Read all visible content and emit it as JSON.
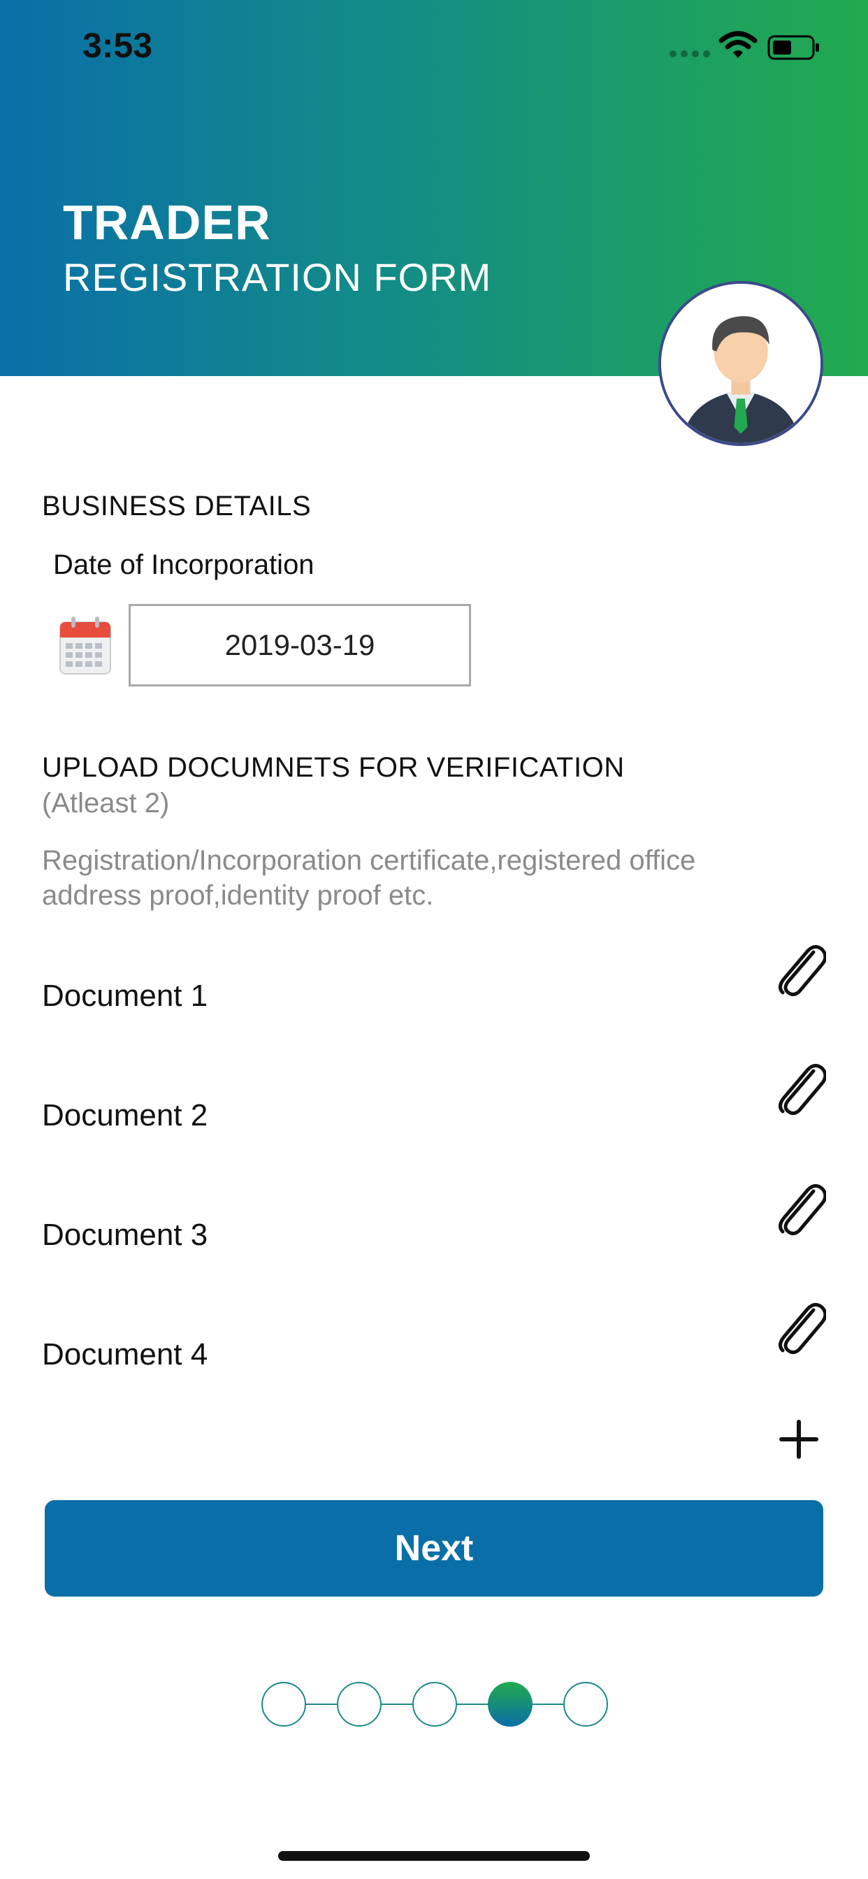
{
  "status_bar": {
    "time": "3:53"
  },
  "header": {
    "title": "TRADER",
    "subtitle": "REGISTRATION FORM",
    "avatar_icon": "businessman-avatar-icon"
  },
  "business": {
    "section_title": "BUSINESS DETAILS",
    "date_label": "Date of Incorporation",
    "date_value": "2019-03-19",
    "calendar_icon": "calendar-icon"
  },
  "upload": {
    "section_title": "UPLOAD DOCUMNETS FOR VERIFICATION",
    "note": "(Atleast 2)",
    "description_line1": "Registration/Incorporation certificate,registered office",
    "description_line2": "address proof,identity proof etc.",
    "documents": [
      {
        "label": "Document 1",
        "icon": "paperclip-icon"
      },
      {
        "label": "Document 2",
        "icon": "paperclip-icon"
      },
      {
        "label": "Document 3",
        "icon": "paperclip-icon"
      },
      {
        "label": "Document 4",
        "icon": "paperclip-icon"
      }
    ],
    "add_icon": "plus-icon"
  },
  "next_button": {
    "label": "Next"
  },
  "stepper": {
    "total_steps": 5,
    "current_step": 4
  },
  "colors": {
    "gradient_start": "#0a6fa8",
    "gradient_end": "#22aa4e",
    "button": "#0a6fa8",
    "secondary_text": "#8a8a8a"
  }
}
